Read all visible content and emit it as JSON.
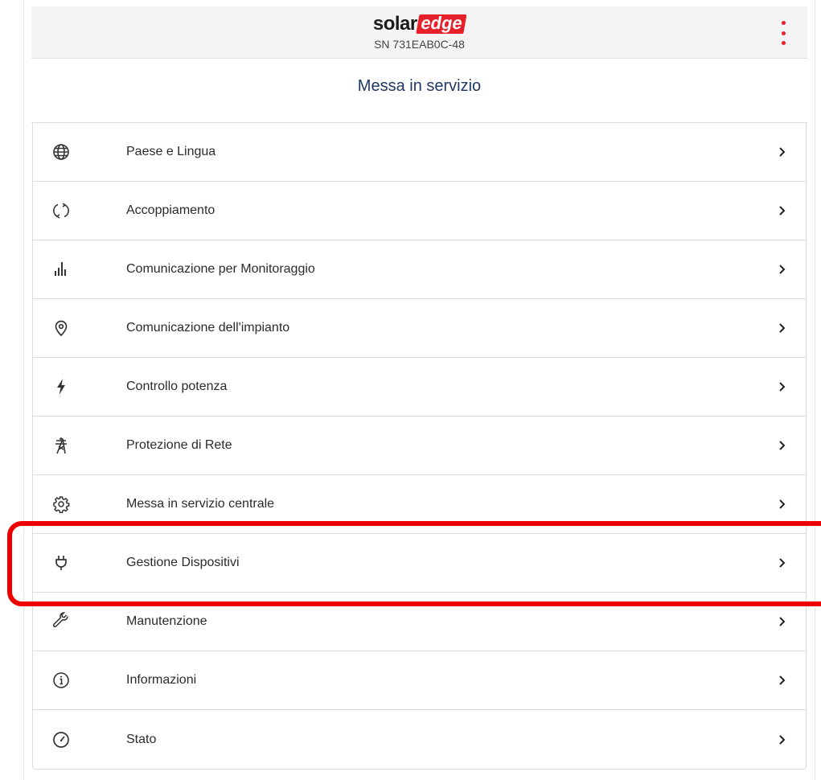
{
  "header": {
    "logo_primary": "solar",
    "logo_secondary": "edge",
    "serial": "SN 731EAB0C-48",
    "menu_icon": "kebab-menu-icon"
  },
  "page": {
    "title": "Messa in servizio"
  },
  "menu": {
    "items": [
      {
        "label": "Paese e Lingua",
        "icon": "globe-icon"
      },
      {
        "label": "Accoppiamento",
        "icon": "sync-icon"
      },
      {
        "label": "Comunicazione per Monitoraggio",
        "icon": "bar-chart-icon"
      },
      {
        "label": "Comunicazione dell'impianto",
        "icon": "location-pin-icon"
      },
      {
        "label": "Controllo potenza",
        "icon": "lightning-icon"
      },
      {
        "label": "Protezione di Rete",
        "icon": "power-tower-icon"
      },
      {
        "label": "Messa in servizio centrale",
        "icon": "gear-icon"
      },
      {
        "label": "Gestione Dispositivi",
        "icon": "plug-icon",
        "highlighted": true
      },
      {
        "label": "Manutenzione",
        "icon": "wrench-icon"
      },
      {
        "label": "Informazioni",
        "icon": "info-icon"
      },
      {
        "label": "Stato",
        "icon": "gauge-icon"
      }
    ]
  },
  "colors": {
    "brand_red": "#e8202a",
    "title_blue": "#1f3763",
    "highlight_red": "#ee0000"
  }
}
